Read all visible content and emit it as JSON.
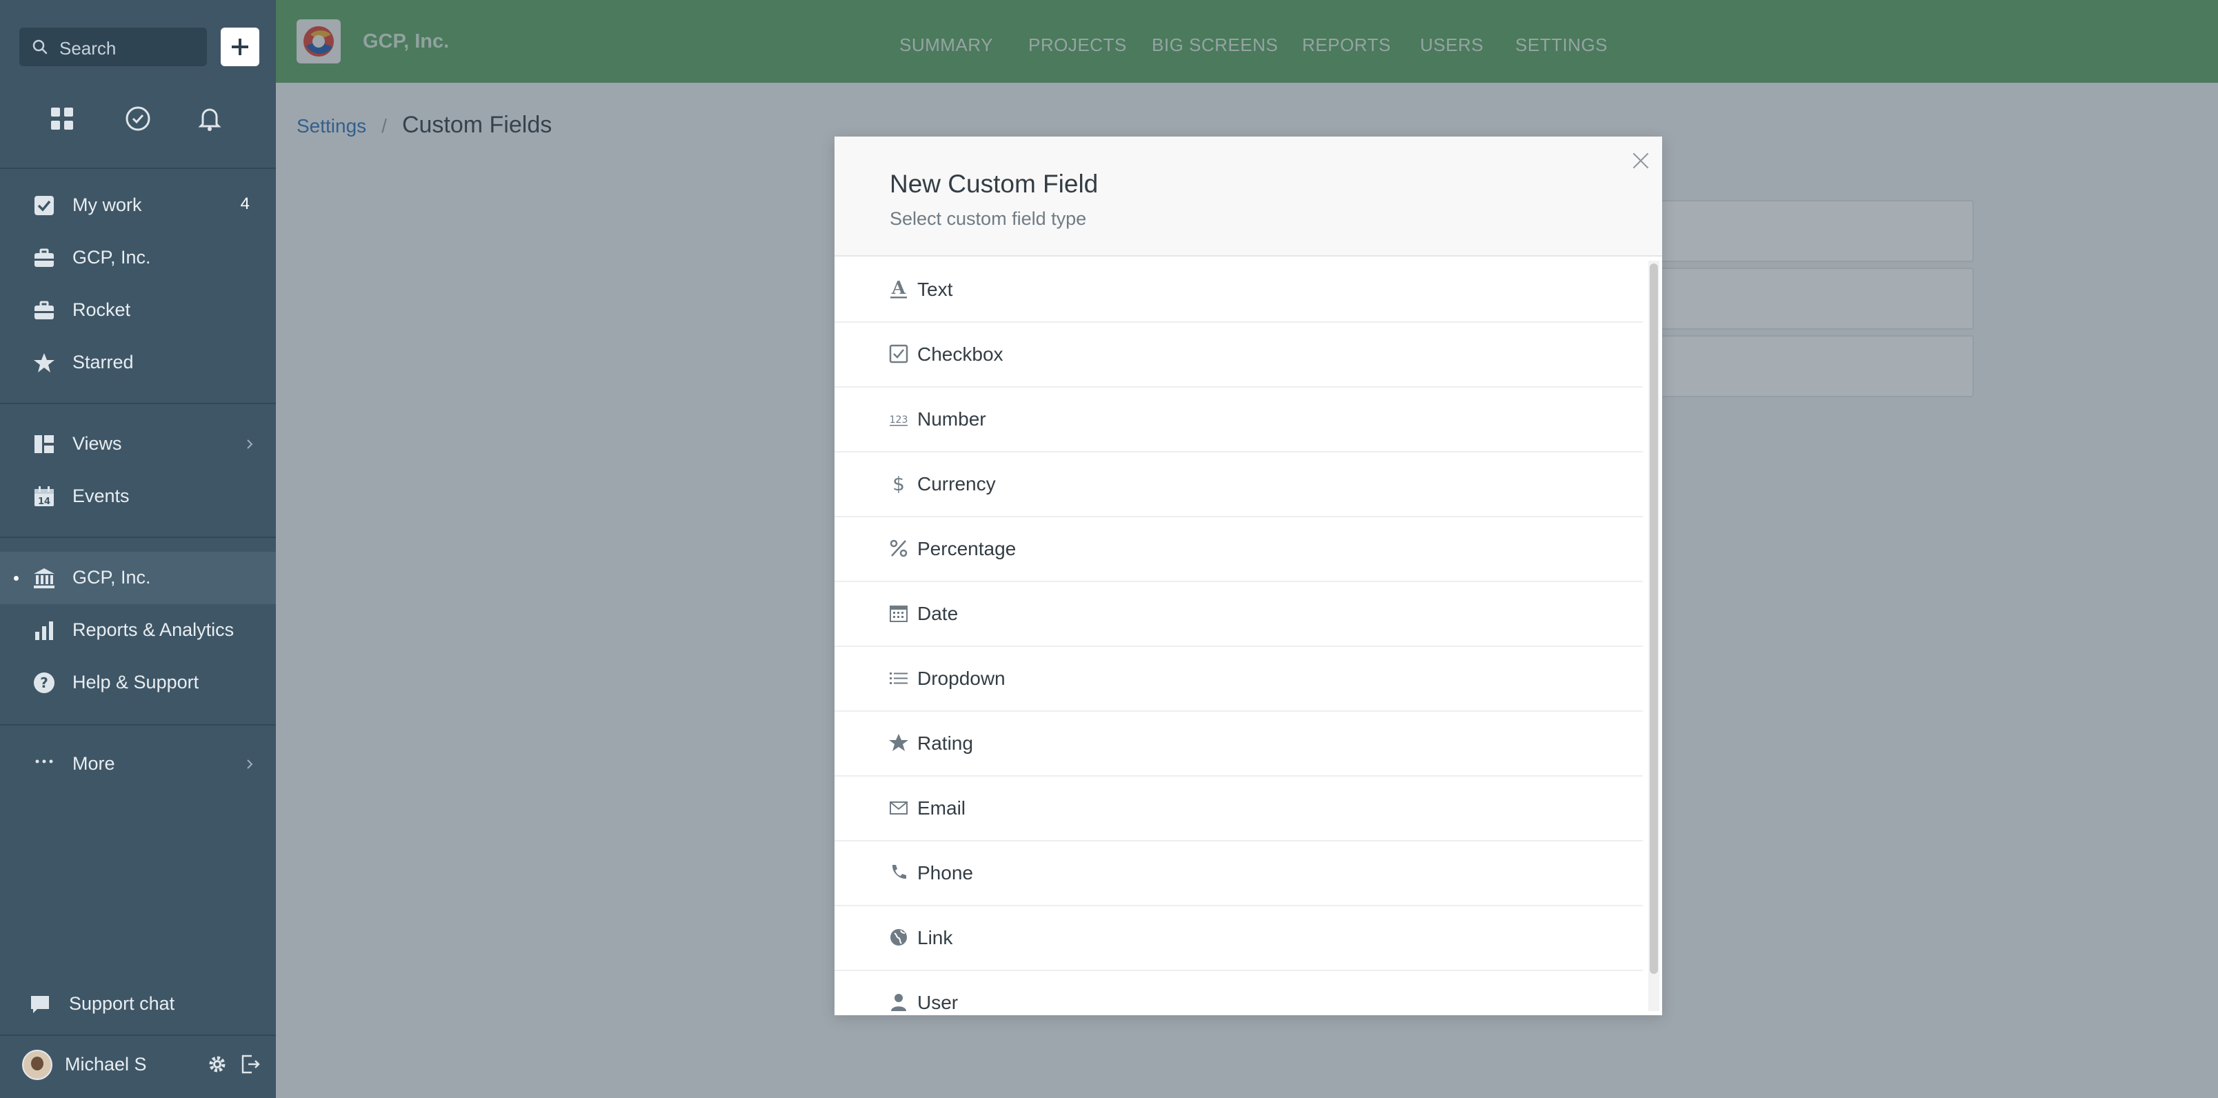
{
  "sidebar": {
    "search_placeholder": "Search",
    "quick_icons": [
      "dashboard-icon",
      "timer-icon",
      "bell-icon"
    ],
    "items": [
      {
        "label": "My work",
        "icon": "checkbox-icon",
        "count": "4"
      },
      {
        "label": "GCP, Inc.",
        "icon": "briefcase-icon"
      },
      {
        "label": "Rocket",
        "icon": "briefcase-icon"
      },
      {
        "label": "Starred",
        "icon": "star-icon"
      },
      {
        "label": "Views",
        "icon": "views-icon"
      },
      {
        "label": "Events",
        "icon": "calendar-icon"
      },
      {
        "label": "GCP, Inc.",
        "icon": "bank-icon"
      },
      {
        "label": "Reports & Analytics",
        "icon": "bar-chart-icon"
      },
      {
        "label": "Help & Support",
        "icon": "help-icon"
      },
      {
        "label": "More",
        "icon": "dots-icon"
      }
    ],
    "support_chat": "Support chat",
    "user_name": "Michael S"
  },
  "topbar": {
    "brand": "GCP, Inc.",
    "nav": [
      "SUMMARY",
      "PROJECTS",
      "BIG SCREENS",
      "REPORTS",
      "USERS",
      "SETTINGS"
    ]
  },
  "breadcrumb": {
    "parent": "Settings",
    "separator": "/",
    "current": "Custom Fields"
  },
  "modal": {
    "title": "New Custom Field",
    "subtitle": "Select custom field type",
    "fields": [
      {
        "label": "Text",
        "icon": "text-icon"
      },
      {
        "label": "Checkbox",
        "icon": "checkbox-icon"
      },
      {
        "label": "Number",
        "icon": "number-icon"
      },
      {
        "label": "Currency",
        "icon": "dollar-icon"
      },
      {
        "label": "Percentage",
        "icon": "percent-icon"
      },
      {
        "label": "Date",
        "icon": "calendar-icon"
      },
      {
        "label": "Dropdown",
        "icon": "list-icon"
      },
      {
        "label": "Rating",
        "icon": "star-icon"
      },
      {
        "label": "Email",
        "icon": "envelope-icon"
      },
      {
        "label": "Phone",
        "icon": "phone-icon"
      },
      {
        "label": "Link",
        "icon": "globe-icon"
      },
      {
        "label": "User",
        "icon": "user-icon"
      }
    ]
  },
  "colors": {
    "sidebar_bg": "#3f5666",
    "topbar_bg": "#64a96c",
    "link": "#3b7bbd",
    "text_dark": "#333d44"
  }
}
